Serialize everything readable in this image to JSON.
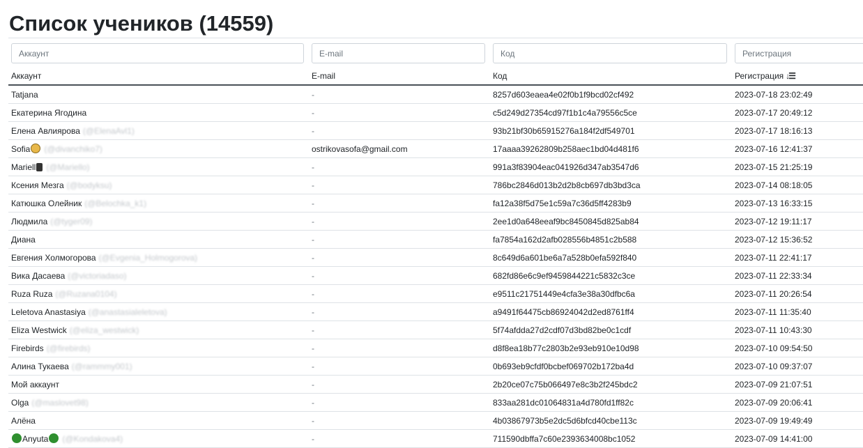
{
  "page": {
    "title": "Список учеников (14559)"
  },
  "filters": {
    "account_placeholder": "Аккаунт",
    "email_placeholder": "E-mail",
    "code_placeholder": "Код",
    "registration_placeholder": "Регистрация"
  },
  "columns": {
    "account": "Аккаунт",
    "email": "E-mail",
    "code": "Код",
    "registration": "Регистрация",
    "sort_icon": "sort-descending-icon"
  },
  "rows": [
    {
      "name": "Tatjana",
      "handle": "",
      "emoji_before": "",
      "emoji_after": "",
      "email": "-",
      "code": "8257d603eaea4e02f0b1f9bcd02cf492",
      "registered": "2023-07-18 23:02:49"
    },
    {
      "name": "Екатерина Ягодина",
      "handle": "",
      "emoji_before": "",
      "emoji_after": "",
      "email": "-",
      "code": "c5d249d27354cd97f1b1c4a79556c5ce",
      "registered": "2023-07-17 20:49:12"
    },
    {
      "name": "Елена Авлиярова",
      "handle": "(@ElenaAvl1)",
      "emoji_before": "",
      "emoji_after": "",
      "email": "-",
      "code": "93b21bf30b65915276a184f2df549701",
      "registered": "2023-07-17 18:16:13"
    },
    {
      "name": "Sofia",
      "handle": "(@divanchiko7)",
      "emoji_before": "",
      "emoji_after": "face-emoji",
      "email": "ostrikovasofa@gmail.com",
      "code": "17aaaa39262809b258aec1bd04d481f6",
      "registered": "2023-07-16 12:41:37"
    },
    {
      "name": "Mariell",
      "handle": "(@Mariello)",
      "emoji_before": "",
      "emoji_after": "note-emoji",
      "email": "-",
      "code": "991a3f83904eac041926d347ab3547d6",
      "registered": "2023-07-15 21:25:19"
    },
    {
      "name": "Ксения Мезга",
      "handle": "(@bodyksu)",
      "emoji_before": "",
      "emoji_after": "",
      "email": "-",
      "code": "786bc2846d013b2d2b8cb697db3bd3ca",
      "registered": "2023-07-14 08:18:05"
    },
    {
      "name": "Катюшка Олейник",
      "handle": "(@Belochka_k1)",
      "emoji_before": "",
      "emoji_after": "",
      "email": "-",
      "code": "fa12a38f5d75e1c59a7c36d5ff4283b9",
      "registered": "2023-07-13 16:33:15"
    },
    {
      "name": "Людмила",
      "handle": "(@tyger09)",
      "emoji_before": "",
      "emoji_after": "",
      "email": "-",
      "code": "2ee1d0a648eeaf9bc8450845d825ab84",
      "registered": "2023-07-12 19:11:17"
    },
    {
      "name": "Диана",
      "handle": "",
      "emoji_before": "",
      "emoji_after": "",
      "email": "-",
      "code": "fa7854a162d2afb028556b4851c2b588",
      "registered": "2023-07-12 15:36:52"
    },
    {
      "name": "Евгения Холмогорова",
      "handle": "(@Evgenia_Holmogorova)",
      "emoji_before": "",
      "emoji_after": "",
      "email": "-",
      "code": "8c649d6a601be6a7a528b0efa592f840",
      "registered": "2023-07-11 22:41:17"
    },
    {
      "name": "Вика Дасаева",
      "handle": "(@victoriadaso)",
      "emoji_before": "",
      "emoji_after": "",
      "email": "-",
      "code": "682fd86e6c9ef9459844221c5832c3ce",
      "registered": "2023-07-11 22:33:34"
    },
    {
      "name": "Ruza Ruza",
      "handle": "(@Ruzana0104)",
      "emoji_before": "",
      "emoji_after": "",
      "email": "-",
      "code": "e9511c21751449e4cfa3e38a30dfbc6a",
      "registered": "2023-07-11 20:26:54"
    },
    {
      "name": "Leletova Anastasiya",
      "handle": "(@anastasialeletova)",
      "emoji_before": "",
      "emoji_after": "",
      "email": "-",
      "code": "a9491f64475cb86924042d2ed8761ff4",
      "registered": "2023-07-11 11:35:40"
    },
    {
      "name": "Eliza Westwick",
      "handle": "(@eliza_westwick)",
      "emoji_before": "",
      "emoji_after": "",
      "email": "-",
      "code": "5f74afdda27d2cdf07d3bd82be0c1cdf",
      "registered": "2023-07-11 10:43:30"
    },
    {
      "name": "Firebirds",
      "handle": "(@firebirds)",
      "emoji_before": "",
      "emoji_after": "",
      "email": "-",
      "code": "d8f8ea18b77c2803b2e93eb910e10d98",
      "registered": "2023-07-10 09:54:50"
    },
    {
      "name": "Алина Тукаева",
      "handle": "(@rammmy001)",
      "emoji_before": "",
      "emoji_after": "",
      "email": "-",
      "code": "0b693eb9cfdf0bcbef069702b172ba4d",
      "registered": "2023-07-10 09:37:07"
    },
    {
      "name": "Мой аккаунт",
      "handle": "",
      "emoji_before": "",
      "emoji_after": "",
      "email": "-",
      "code": "2b20ce07c75b066497e8c3b2f245bdc2",
      "registered": "2023-07-09 21:07:51"
    },
    {
      "name": "Olga",
      "handle": "(@maslovet98)",
      "emoji_before": "",
      "emoji_after": "",
      "email": "-",
      "code": "833aa281dc01064831a4d780fd1ff82c",
      "registered": "2023-07-09 20:06:41"
    },
    {
      "name": "Алёна",
      "handle": "",
      "emoji_before": "",
      "emoji_after": "",
      "email": "-",
      "code": "4b03867973b5e2dc5d6bfcd40cbe113c",
      "registered": "2023-07-09 19:49:49"
    },
    {
      "name": "Anyuta",
      "handle": "(@Kondakova4)",
      "emoji_before": "clover-emoji",
      "emoji_after": "clover-emoji",
      "email": "-",
      "code": "711590dbffa7c60e2393634008bc1052",
      "registered": "2023-07-09 14:41:00"
    }
  ]
}
